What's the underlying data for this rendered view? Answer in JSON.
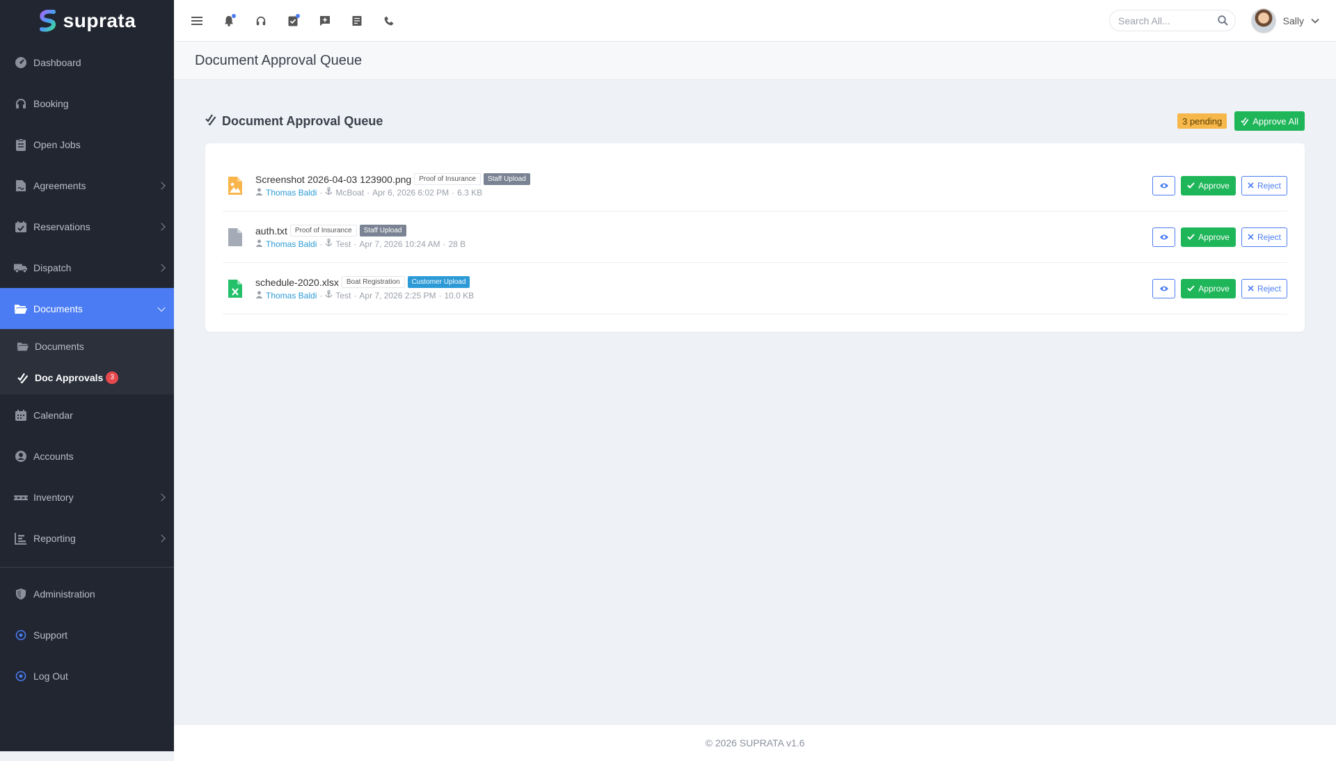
{
  "app": {
    "name": "suprata"
  },
  "sidebar": {
    "items": [
      {
        "label": "Dashboard",
        "icon": "gauge-icon"
      },
      {
        "label": "Booking",
        "icon": "headset-icon"
      },
      {
        "label": "Open Jobs",
        "icon": "clipboard-icon"
      },
      {
        "label": "Agreements",
        "icon": "file-signature-icon",
        "has_children": true
      },
      {
        "label": "Reservations",
        "icon": "calendar-check-icon",
        "has_children": true
      },
      {
        "label": "Dispatch",
        "icon": "truck-icon",
        "has_children": true
      },
      {
        "label": "Documents",
        "icon": "folder-open-icon",
        "has_children": true,
        "active": true,
        "expanded": true
      },
      {
        "label": "Calendar",
        "icon": "calendar-icon"
      },
      {
        "label": "Accounts",
        "icon": "user-circle-icon"
      },
      {
        "label": "Inventory",
        "icon": "pallet-icon",
        "has_children": true
      },
      {
        "label": "Reporting",
        "icon": "bar-chart-icon",
        "has_children": true
      },
      {
        "label": "Administration",
        "icon": "shield-icon"
      },
      {
        "label": "Support",
        "icon": "target-icon"
      },
      {
        "label": "Log Out",
        "icon": "target-icon"
      }
    ],
    "documents_sub": [
      {
        "label": "Documents",
        "icon": "folder-open-icon"
      },
      {
        "label": "Doc Approvals",
        "icon": "double-check-icon",
        "badge": "3",
        "current": true
      }
    ]
  },
  "topbar": {
    "icons": [
      "menu-icon",
      "bell-icon",
      "headset-icon",
      "task-icon",
      "message-plus-icon",
      "notes-icon",
      "phone-icon"
    ],
    "search_placeholder": "Search All...",
    "user_name": "Sally"
  },
  "page": {
    "title": "Document Approval Queue"
  },
  "queue": {
    "title": "Document Approval Queue",
    "pending_label": "3 pending",
    "approve_all_label": "Approve All",
    "documents": [
      {
        "filename": "Screenshot 2026-04-03 123900.png",
        "file_icon": "image-file-icon",
        "category": "Proof of Insurance",
        "source": "Staff Upload",
        "uploader": "Thomas Baldi",
        "boat": "McBoat",
        "date": "Apr 6, 2026 6:02 PM",
        "size": "6.3 KB"
      },
      {
        "filename": "auth.txt",
        "file_icon": "text-file-icon",
        "category": "Proof of Insurance",
        "source": "Staff Upload",
        "uploader": "Thomas Baldi",
        "boat": "Test",
        "date": "Apr 7, 2026 10:24 AM",
        "size": "28 B"
      },
      {
        "filename": "schedule-2020.xlsx",
        "file_icon": "excel-file-icon",
        "category": "Boat Registration",
        "source": "Customer Upload",
        "uploader": "Thomas Baldi",
        "boat": "Test",
        "date": "Apr 7, 2026 2:25 PM",
        "size": "10.0 KB"
      }
    ],
    "approve_label": "Approve",
    "reject_label": "Reject",
    "separator": "·"
  },
  "footer": {
    "text": "© 2026 SUPRATA v1.6"
  },
  "colors": {
    "sidebar_bg": "#212631",
    "accent": "#4b7cf3",
    "success": "#1fb65a",
    "warning": "#f7b84b",
    "link": "#2b9ad6"
  }
}
